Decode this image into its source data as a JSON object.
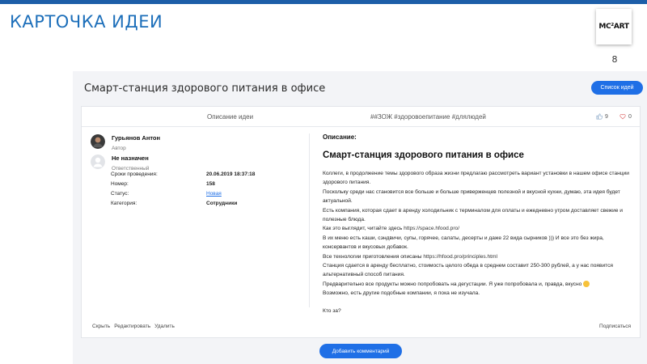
{
  "slide": {
    "title": "КАРТОЧКА ИДЕИ",
    "logo_text": "MC²ART",
    "page_number": "8"
  },
  "app": {
    "title": "Смарт-станция здорового питания в офисе",
    "list_button": "Список идей",
    "tab_description": "Описание идеи",
    "hashtags": "##ЗОЖ #здоровоепитание #длялюдей",
    "likes": "9",
    "dislikes": "0",
    "author": {
      "name": "Гурьянов Антон",
      "role": "Автор"
    },
    "assignee": {
      "name": "Не назначен",
      "role": "Ответственный"
    },
    "info": [
      {
        "key": "Сроки проведения:",
        "value": "20.06.2019 18:37:18"
      },
      {
        "key": "Номер:",
        "value": "158"
      },
      {
        "key": "Статус:",
        "value": "Новая"
      },
      {
        "key": "Категория:",
        "value": "Сотрудники"
      }
    ],
    "description_label": "Описание:",
    "idea_title": "Смарт-станция здорового питания в офисе",
    "paragraphs": [
      "Коллеги, в продолжение темы здорового образа жизни предлагаю рассмотреть вариант установки в нашем офисе станции здорового питания.",
      "Поскольку среди нас становится все больше и больше приверженцев полезной и вкусной кухни, думаю, эта идея будет актуальной.",
      "Есть компания, которая сдает в аренду холодильник с терминалом для оплаты и ежедневно утром доставляет свежие и полезные блюда."
    ],
    "look_text": "Как это выглядит, читайте здесь",
    "look_link": "https://space.hfood.pro/",
    "menu_text": "В их меню есть каши, сэндвичи, супы, горячее, салаты, десерты и даже 22 вида сырников ))) И все это без жира, консервантов и вкусовых добавок.",
    "tech_text": "Все технологии приготовления описаны",
    "tech_link": "https://hfood.pro/principles.html",
    "rent_text": "Станция сдается в аренду бесплатно, стоимость целого обеда в среднем составит 250-300 рублей, а у нас появится альтернативный способ питания.",
    "tasting_text": "Предварительно все продукты можно попробовать на дегустации. Я уже попробовала и, правда, вкусно",
    "others_text": "Возможно, есть другие подобные компании, я пока не изучала.",
    "who_text": "Кто за?",
    "actions": {
      "hide": "Скрыть",
      "edit": "Редактировать",
      "delete": "Удалить"
    },
    "subscribe": "Подписаться",
    "comment_button": "Добавить комментарий"
  }
}
